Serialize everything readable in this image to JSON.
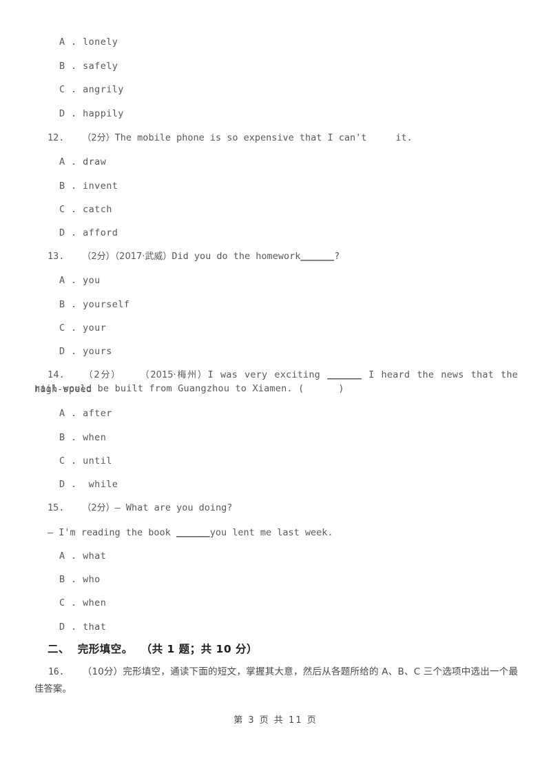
{
  "document": {
    "page_label": "第 3 页 共 11 页",
    "background_color": "#ffffff",
    "text_color": "#585858"
  },
  "questions": [
    {
      "id": "q11-options",
      "options": [
        "A . lonely",
        "B . safely",
        "C . angrily",
        "D . happily"
      ]
    },
    {
      "id": "q12",
      "number": "12.",
      "marks": "（2分）",
      "stem_before": "The mobile phone is so expensive that I can't",
      "stem_after": "it.",
      "options": [
        "A . draw",
        "B . invent",
        "C . catch",
        "D . afford"
      ]
    },
    {
      "id": "q13",
      "number": "13.",
      "marks": "（2分）",
      "source": "（2017·武威）",
      "stem_before": "Did you do the homework",
      "blank": "______",
      "stem_after": "?",
      "options": [
        "A . you",
        "B . yourself",
        "C . your",
        "D . yours"
      ]
    },
    {
      "id": "q14",
      "number": "14.",
      "marks": "（2分）",
      "source": "（2015·梅州）",
      "stem_line1_before": "I was very exciting",
      "stem_line1_blank": "______",
      "stem_line1_after": "I heard the news that the high-speed",
      "stem_line2": "rail would be built from Guangzhou to Xiamen. (      )",
      "options": [
        "A . after",
        "B . when",
        "C . until",
        "D .  while"
      ]
    },
    {
      "id": "q15",
      "number": "15.",
      "marks": "（2分）",
      "stem_line1": "— What are you doing?",
      "stem_line2_before": "— I'm reading the book ",
      "stem_line2_blank": "______",
      "stem_line2_after": "you lent me last week.",
      "options": [
        "A . what",
        "B . who",
        "C . when",
        "D . that"
      ]
    },
    {
      "id": "q16",
      "number": "16.",
      "marks": "（10分）",
      "body": "完形填空，通读下面的短文，掌握其大意，然后从各题所给的 A、B、C 三个选项中选出一个最佳答案。"
    }
  ],
  "section": {
    "heading": "二、  完形填空。  （共 1 题；共 10 分）"
  }
}
